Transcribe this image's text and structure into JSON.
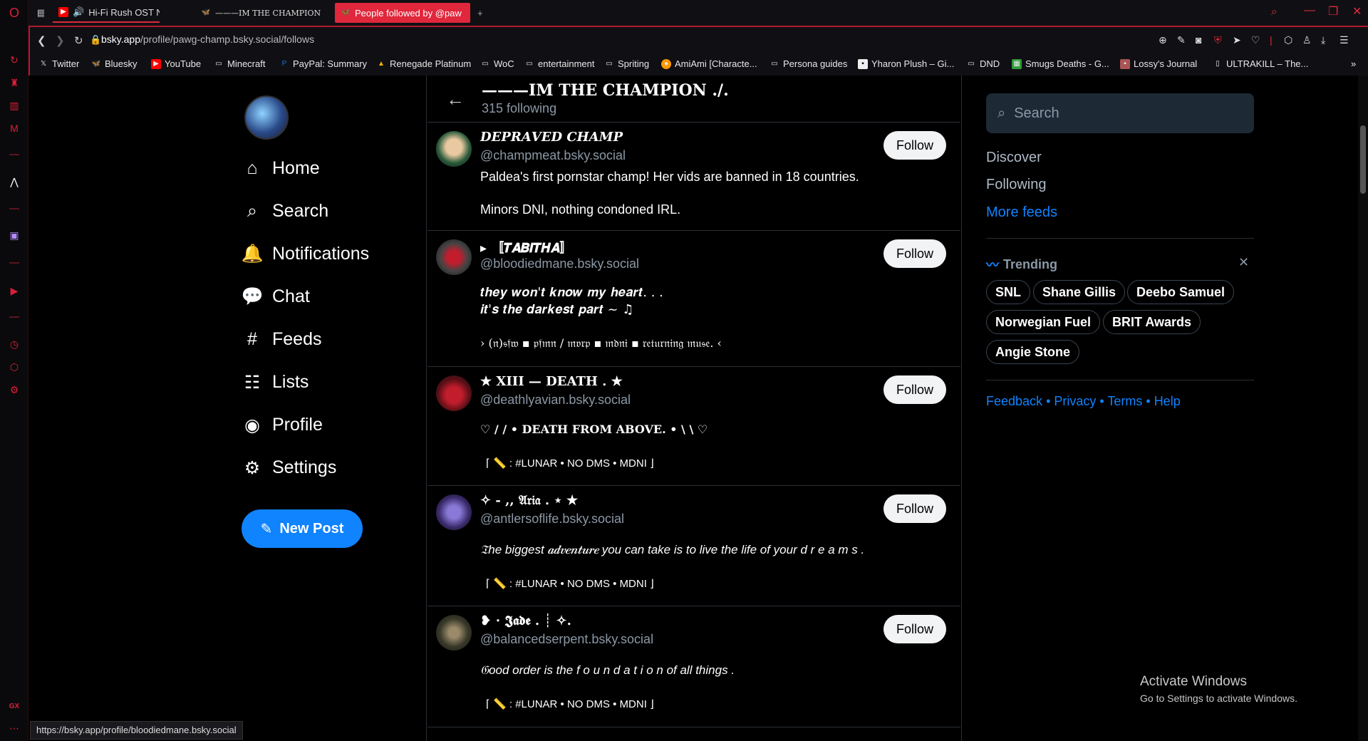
{
  "browser": {
    "tabs": [
      {
        "label": "Hi-Fi Rush OST Negotia",
        "icon": "youtube-icon",
        "audio": "speaker-icon"
      },
      {
        "label": "———IM THE CHAMPION ./.",
        "icon": "bluesky-icon"
      },
      {
        "label": "People followed by @paw",
        "icon": "bluesky-icon"
      }
    ],
    "url_host": "bsky.app",
    "url_path": "/profile/pawg-champ.bsky.social/follows",
    "bookmarks": [
      "Twitter",
      "Bluesky",
      "YouTube",
      "Minecraft",
      "PayPal: Summary",
      "Renegade Platinum",
      "WoC",
      "entertainment",
      "Spriting",
      "AmiAmi [Characte...",
      "Persona guides",
      "Yharon Plush – Gi...",
      "DND",
      "Smugs Deaths - G...",
      "Lossy's Journal",
      "ULTRAKILL – The..."
    ],
    "status_url": "https://bsky.app/profile/bloodiedmane.bsky.social",
    "sidebar_label": "GX",
    "accent": "#e0273c"
  },
  "nav": {
    "items": [
      "Home",
      "Search",
      "Notifications",
      "Chat",
      "Feeds",
      "Lists",
      "Profile",
      "Settings"
    ],
    "new_post": "New Post"
  },
  "header": {
    "title": "———IM THE CHAMPION ./.",
    "subtitle": "315 following"
  },
  "follows": [
    {
      "name": "𝑫𝑬𝑷𝑹𝑨𝑽𝑬𝑫 𝑪𝑯𝑨𝑴𝑷",
      "handle": "@champmeat.bsky.social",
      "bio": [
        "Paldea's first pornstar champ! Her vids are banned in 18 countries.",
        "Minors DNI, nothing condoned IRL."
      ],
      "button": "Follow"
    },
    {
      "name": "▸ 〚𝑻𝑨𝑩𝑰𝑻𝑯𝑨〛",
      "handle": "@bloodiedmane.bsky.social",
      "bio": [
        "𝒕𝒉𝒆𝒚 𝒘𝒐𝒏'𝒕 𝒌𝒏𝒐𝒘 𝒎𝒚 𝒉𝒆𝒂𝒓𝒕. . .",
        "𝒊𝒕'𝒔 𝒕𝒉𝒆 𝒅𝒂𝒓𝒌𝒆𝒔𝒕 𝒑𝒂𝒓𝒕 ~ ♫",
        "› (𝔫)𝔰𝔣𝔴 ▪ 𝔭𝔣𝔪𝔫 / 𝔪𝔳𝔯𝔭 ▪ 𝔪𝔡𝔫𝔦 ▪ 𝔯𝔢𝔱𝔲𝔯𝔫𝔦𝔫𝔤 𝔪𝔲𝔰𝔢. ‹"
      ],
      "button": "Follow"
    },
    {
      "name": "★ XIII — DEATH . ★",
      "handle": "@deathlyavian.bsky.social",
      "bio": [
        "♡ / / • DEATH FROM ABOVE. • \\ \\ ♡",
        "⌈ 📏 : #LUNAR • NO DMS • MDNI ⌋"
      ],
      "button": "Follow"
    },
    {
      "name": "✧ - ,, 𝔄𝔯𝔦𝔞 . ⋆ ★",
      "handle": "@antlersoflife.bsky.social",
      "bio": [
        "𝔗he biggest 𝒂𝒅𝒗𝒆𝒏𝒕𝒖𝒓𝒆 you can take is to live the life of your  d r e a m s .",
        "⌈ 📏 : #LUNAR • NO DMS • MDNI ⌋"
      ],
      "button": "Follow"
    },
    {
      "name": "❥ ⋅ 𝕵𝖆𝖉𝖊 . ┊ ✧.",
      "handle": "@balancedserpent.bsky.social",
      "bio": [
        "𝔊ood order is the  f o u n d a t i o n  of all things .",
        "⌈ 📏 : #LUNAR • NO DMS • MDNI ⌋"
      ],
      "button": "Follow"
    }
  ],
  "right": {
    "search_placeholder": "Search",
    "feeds": [
      "Discover",
      "Following",
      "More feeds"
    ],
    "trending_title": "Trending",
    "trending": [
      "SNL",
      "Shane Gillis",
      "Deebo Samuel",
      "Norwegian Fuel",
      "BRIT Awards",
      "Angie Stone"
    ],
    "footer": [
      "Feedback",
      "Privacy",
      "Terms",
      "Help"
    ],
    "link_color": "#1083fe"
  },
  "watermark": {
    "title": "Activate Windows",
    "subtitle": "Go to Settings to activate Windows."
  }
}
